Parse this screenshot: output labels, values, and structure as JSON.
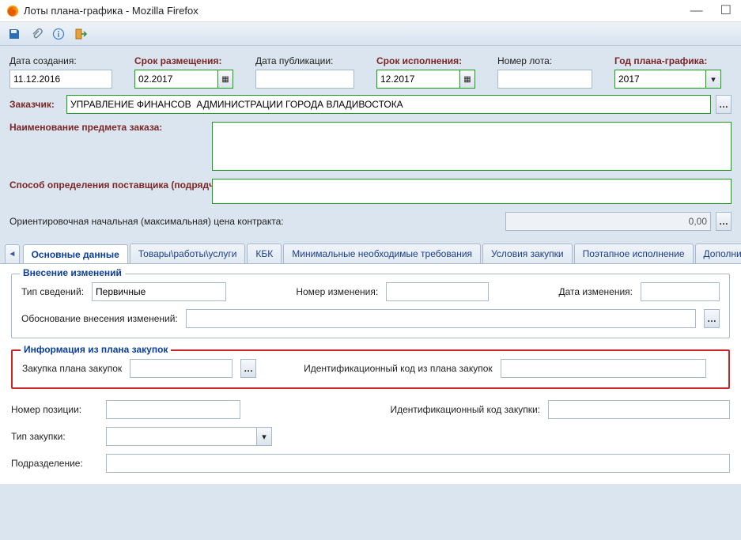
{
  "window": {
    "title": "Лоты плана-графика - Mozilla Firefox"
  },
  "toolbar": {
    "save": "save-icon",
    "attach": "paperclip-icon",
    "info": "info-icon",
    "exit": "exit-icon"
  },
  "top": {
    "create_date_label": "Дата создания:",
    "create_date_value": "11.12.2016",
    "placement_label": "Срок размещения:",
    "placement_value": "02.2017",
    "publish_label": "Дата публикации:",
    "publish_value": "",
    "exec_label": "Срок исполнения:",
    "exec_value": "12.2017",
    "lot_no_label": "Номер лота:",
    "lot_no_value": "",
    "year_label": "Год плана-графика:",
    "year_value": "2017"
  },
  "customer": {
    "label": "Заказчик:",
    "value": "УПРАВЛЕНИЕ ФИНАНСОВ  АДМИНИСТРАЦИИ ГОРОДА ВЛАДИВОСТОКА"
  },
  "subject": {
    "label": "Наименование предмета заказа:",
    "value": ""
  },
  "supplier_method": {
    "label": "Способ определения поставщика (подрядчика,исполнителя):",
    "value": ""
  },
  "price": {
    "label": "Ориентировочная начальная (максимальная) цена контракта:",
    "value": "0,00"
  },
  "tabs": {
    "items": [
      "Основные данные",
      "Товары\\работы\\услуги",
      "КБК",
      "Минимальные необходимые требования",
      "Условия закупки",
      "Поэтапное исполнение",
      "Дополнительные да"
    ],
    "active_index": 0
  },
  "changes": {
    "legend": "Внесение изменений",
    "type_label": "Тип сведений:",
    "type_value": "Первичные",
    "num_label": "Номер изменения:",
    "num_value": "",
    "date_label": "Дата изменения:",
    "date_value": "",
    "reason_label": "Обоснование внесения изменений:",
    "reason_value": ""
  },
  "plan_info": {
    "legend": "Информация из плана закупок",
    "purchase_label": "Закупка плана закупок",
    "purchase_value": "",
    "idcode_label": "Идентификационный код из плана закупок",
    "idcode_value": ""
  },
  "bottom": {
    "pos_label": "Номер позиции:",
    "pos_value": "",
    "idz_label": "Идентификационный код закупки:",
    "idz_value": "",
    "type_label": "Тип закупки:",
    "type_value": "",
    "div_label": "Подразделение:",
    "div_value": ""
  }
}
